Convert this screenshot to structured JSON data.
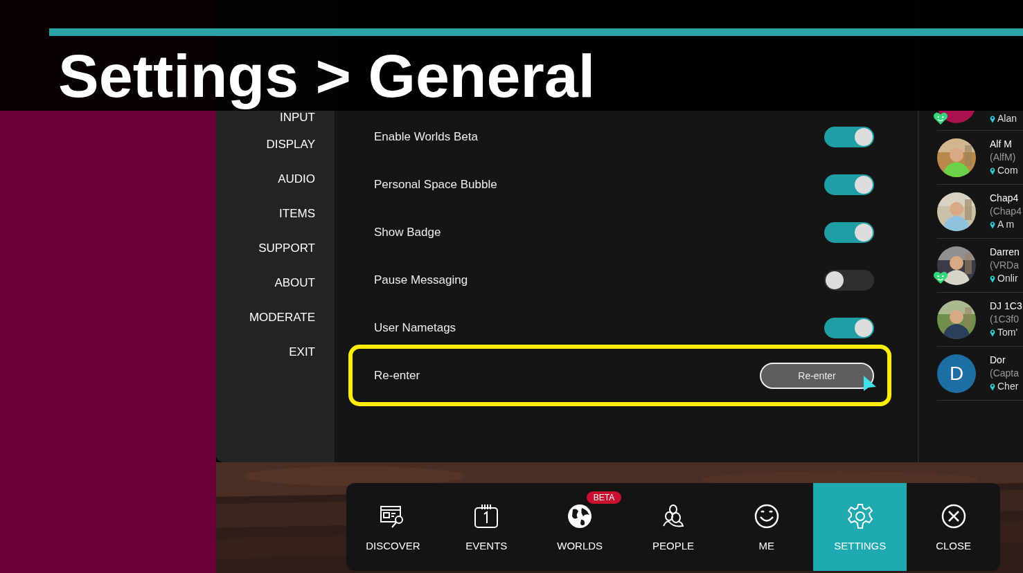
{
  "banner": {
    "title": "Settings > General"
  },
  "sidebar": {
    "items": [
      {
        "label": "INPUT"
      },
      {
        "label": "DISPLAY"
      },
      {
        "label": "AUDIO"
      },
      {
        "label": "ITEMS"
      },
      {
        "label": "SUPPORT"
      },
      {
        "label": "ABOUT"
      },
      {
        "label": "MODERATE"
      },
      {
        "label": "EXIT"
      }
    ]
  },
  "settings": [
    {
      "kind": "toggle",
      "label": "Enable Worlds Beta",
      "on": true
    },
    {
      "kind": "toggle",
      "label": "Personal Space Bubble",
      "on": true
    },
    {
      "kind": "toggle",
      "label": "Show Badge",
      "on": true
    },
    {
      "kind": "toggle",
      "label": "Pause Messaging",
      "on": false
    },
    {
      "kind": "toggle",
      "label": "User Nametags",
      "on": true
    },
    {
      "kind": "button",
      "label": "Re-enter",
      "button": "Re-enter",
      "highlighted": true
    }
  ],
  "friends": {
    "items": [
      {
        "location": "Alan",
        "kind": "partial",
        "color": "#a8124f",
        "online": true
      },
      {
        "name": "Alf M",
        "handle": "(AlfM)",
        "location": "Com",
        "kind": "picture",
        "online": false
      },
      {
        "name": "Chap4",
        "handle": "(Chap4",
        "location": "A m",
        "kind": "picture",
        "online": false
      },
      {
        "name": "Darren",
        "handle": "(VRDa",
        "location": "Onlir",
        "kind": "picture",
        "online": true
      },
      {
        "name": "DJ 1C3",
        "handle": "(1C3f0",
        "location": "Tom'",
        "kind": "picture",
        "online": false
      },
      {
        "name": "Dor",
        "handle": "(Capta",
        "location": "Cher",
        "kind": "letter",
        "letter": "D",
        "color": "#1c6ea4",
        "online": false
      }
    ]
  },
  "dock": [
    {
      "label": "DISCOVER",
      "kind": "discover",
      "selected": false
    },
    {
      "label": "EVENTS",
      "kind": "events",
      "selected": false
    },
    {
      "label": "WORLDS",
      "kind": "worlds",
      "selected": false,
      "badge": "BETA"
    },
    {
      "label": "PEOPLE",
      "kind": "people",
      "selected": false
    },
    {
      "label": "ME",
      "kind": "me",
      "selected": false
    },
    {
      "label": "SETTINGS",
      "kind": "settings",
      "selected": true
    },
    {
      "label": "CLOSE",
      "kind": "close",
      "selected": false
    }
  ]
}
